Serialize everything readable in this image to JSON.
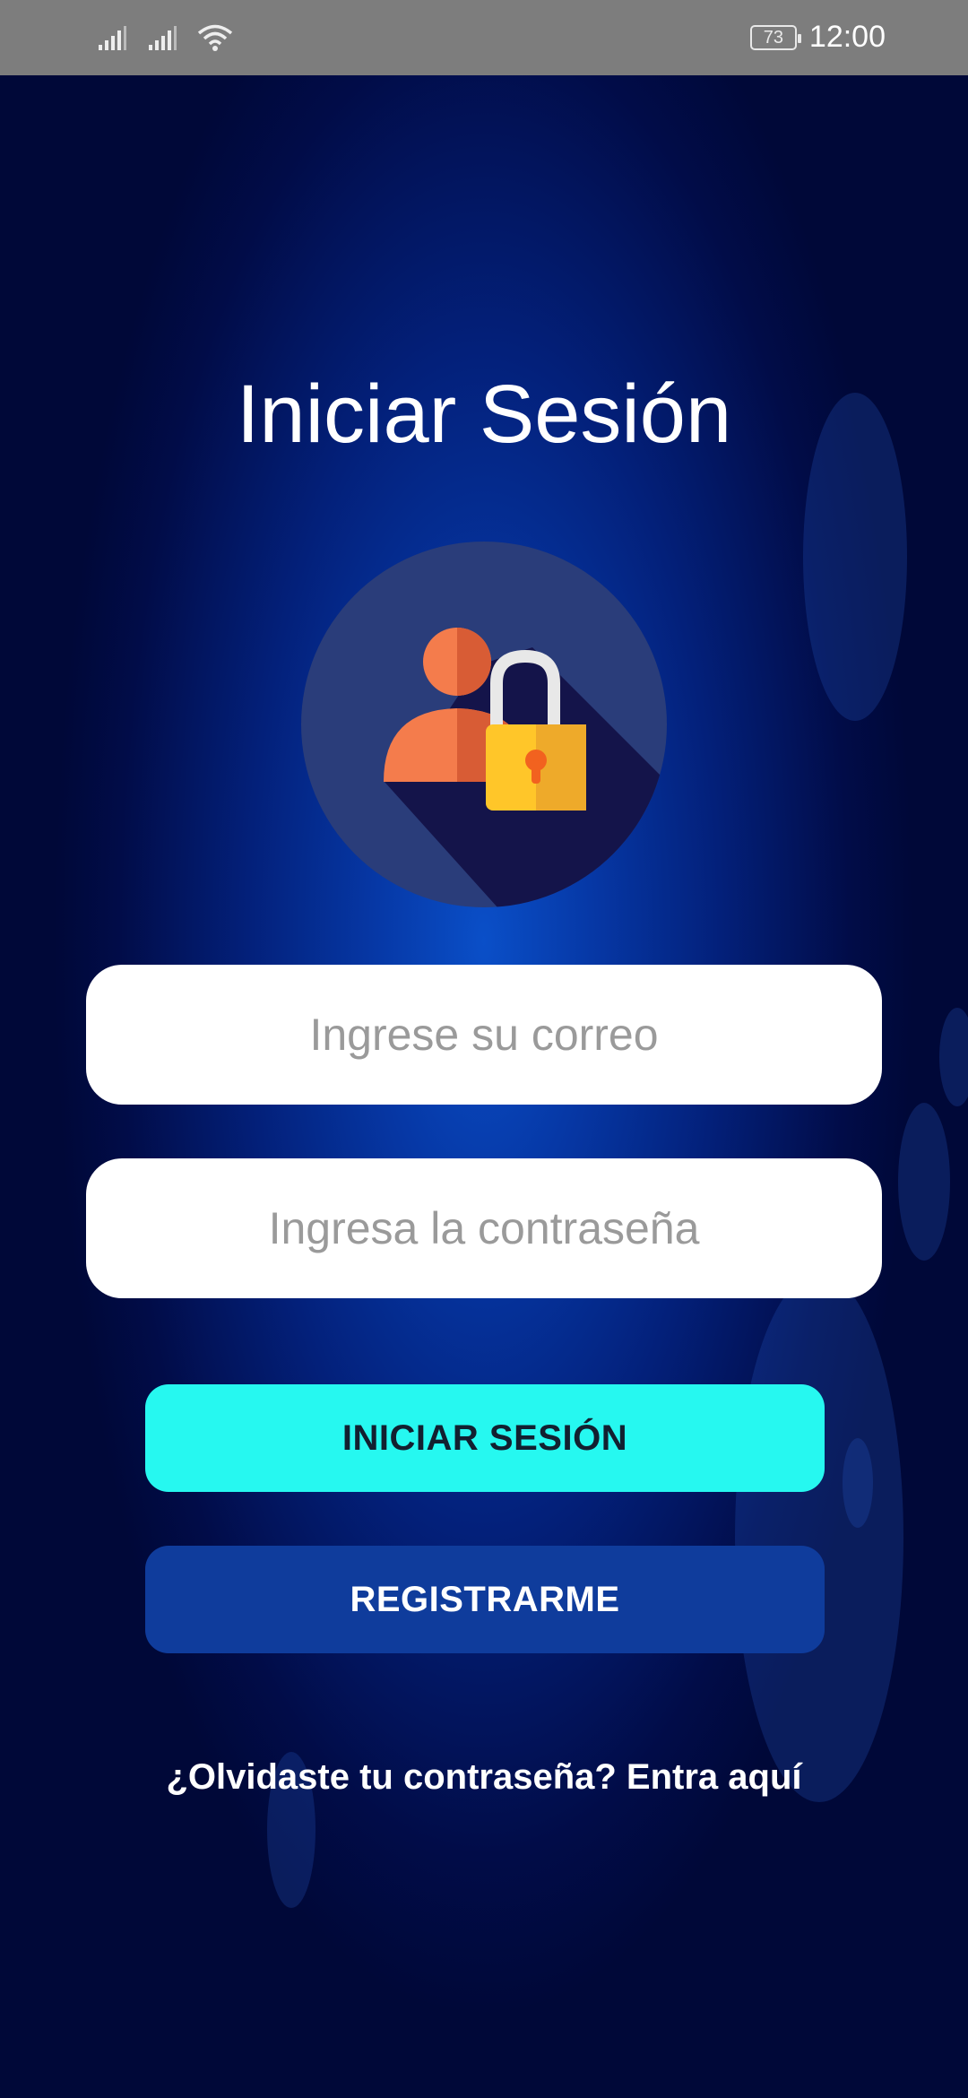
{
  "status_bar": {
    "battery": "73",
    "time": "12:00",
    "icons": [
      "signal-icon",
      "signal-icon",
      "wifi-icon",
      "battery-icon"
    ]
  },
  "login": {
    "title": "Iniciar Sesión",
    "email_placeholder": "Ingrese su correo",
    "password_placeholder": "Ingresa la contraseña",
    "login_button": "INICIAR SESIÓN",
    "register_button": "REGISTRARME",
    "forgot_link": "¿Olvidaste tu contraseña? Entra aquí"
  },
  "colors": {
    "primary_button": "#26f8f0",
    "secondary_button": "#0f3c9c",
    "status_bar": "#7d7d7d"
  }
}
